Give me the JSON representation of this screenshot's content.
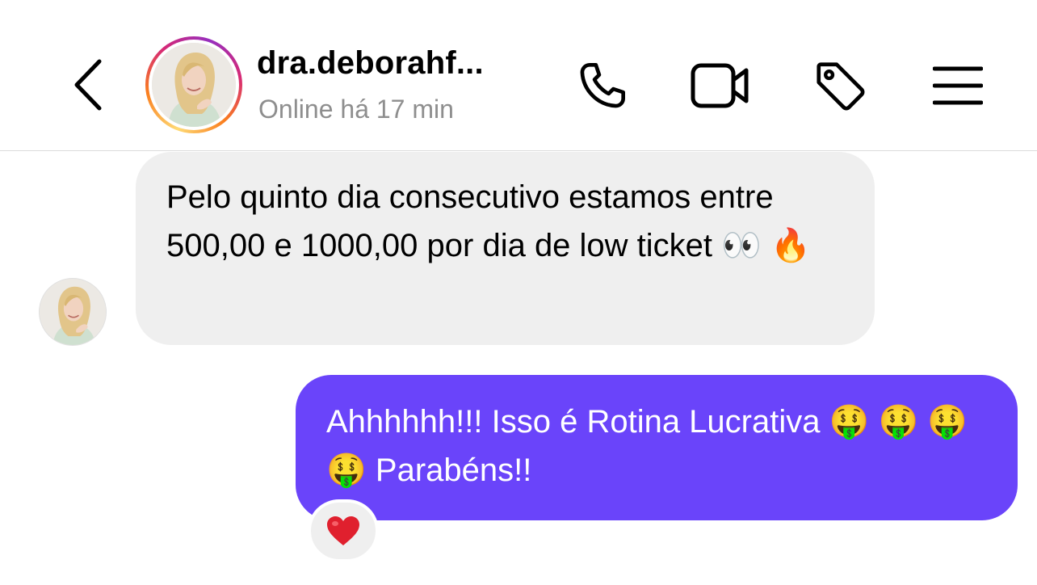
{
  "header": {
    "title": "dra.deborahf...",
    "status": "Online há 17 min",
    "icons": [
      "back-icon",
      "phone-icon",
      "video-icon",
      "tag-icon",
      "menu-icon"
    ]
  },
  "messages": [
    {
      "direction": "incoming",
      "text": "Pelo quinto dia consecutivo estamos entre 500,00 e 1000,00 por dia de low ticket 👀 🔥"
    },
    {
      "direction": "outgoing",
      "text": "Ahhhhhh!!! Isso é Rotina Lucrativa 🤑 🤑 🤑 🤑  Parabéns!!",
      "reaction": "❤️"
    }
  ],
  "colors": {
    "outgoing_bubble": "#6a44fa",
    "incoming_bubble": "#efefef",
    "status_text": "#8e8e8e",
    "reaction_heart": "#e0202e"
  }
}
